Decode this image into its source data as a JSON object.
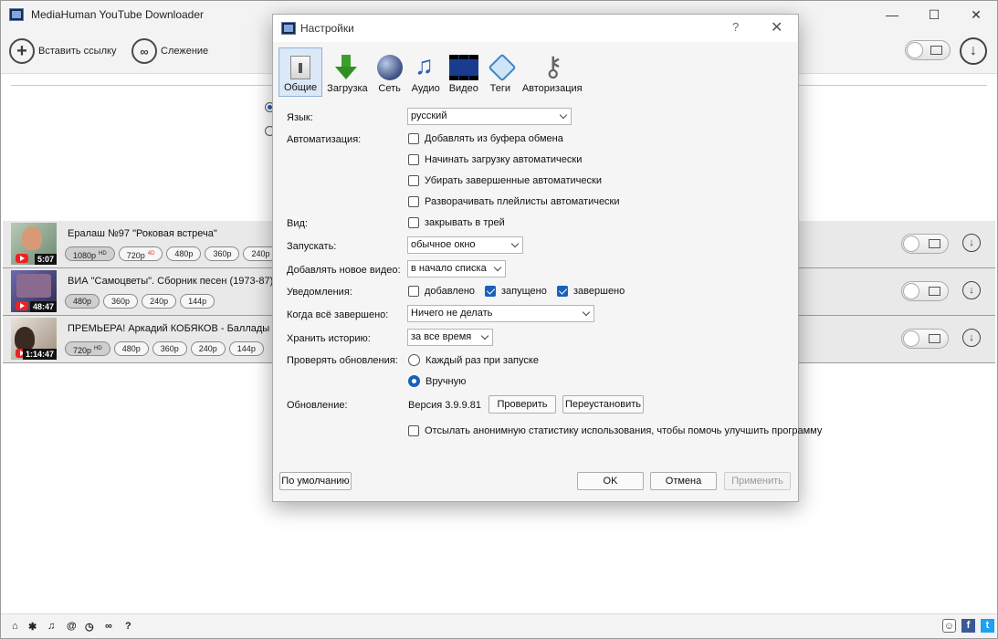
{
  "app": {
    "title": "MediaHuman YouTube Downloader",
    "window_controls": {
      "minimize": "—",
      "maximize": "☐",
      "close": "✕"
    }
  },
  "toolbar": {
    "paste_label": "Вставить ссылку",
    "tracking_label": "Слежение",
    "paste_icon": "plus-circle-icon",
    "tracking_icon": "binoculars-icon"
  },
  "downloads": [
    {
      "title": "Ералаш №97 \"Роковая встреча\"",
      "duration": "5:07",
      "formats": [
        "1080p",
        "720p",
        "480p",
        "360p",
        "240p"
      ],
      "badges": [
        "HD",
        "4D"
      ]
    },
    {
      "title": "ВИА \"Самоцветы\". Сборник песен (1973-87)",
      "duration": "48:47",
      "formats": [
        "480p",
        "360p",
        "240p",
        "144p"
      ]
    },
    {
      "title": "ПРЕМЬЕРА! Аркадий КОБЯКОВ - Баллады и",
      "duration": "1:14:47",
      "formats": [
        "720p",
        "480p",
        "360p",
        "240p",
        "144p"
      ],
      "badges": [
        "HD"
      ]
    }
  ],
  "statusbar": {
    "icons": [
      "mouse-icon",
      "gear-icon",
      "music-icon",
      "snail-icon",
      "clock-icon",
      "binoculars-icon",
      "help-icon"
    ],
    "help_glyph": "?",
    "social": {
      "facebook": "f",
      "twitter": "t"
    }
  },
  "dialog": {
    "title": "Настройки",
    "help": "?",
    "close": "✕",
    "tabs": [
      {
        "label": "Общие",
        "icon": "switch-icon",
        "active": true
      },
      {
        "label": "Загрузка",
        "icon": "download-arrow-icon"
      },
      {
        "label": "Сеть",
        "icon": "globe-icon"
      },
      {
        "label": "Аудио",
        "icon": "music-note-icon"
      },
      {
        "label": "Видео",
        "icon": "film-icon"
      },
      {
        "label": "Теги",
        "icon": "tag-icon"
      },
      {
        "label": "Авторизация",
        "icon": "keys-icon"
      }
    ],
    "language": {
      "label": "Язык:",
      "value": "русский"
    },
    "automation": {
      "label": "Автоматизация:",
      "options": [
        {
          "label": "Добавлять из буфера обмена",
          "checked": false
        },
        {
          "label": "Начинать загрузку автоматически",
          "checked": false
        },
        {
          "label": "Убирать завершенные автоматически",
          "checked": false
        },
        {
          "label": "Разворачивать плейлисты автоматически",
          "checked": false
        }
      ]
    },
    "view": {
      "label": "Вид:",
      "option": "закрывать в трей",
      "checked": false
    },
    "launch": {
      "label": "Запускать:",
      "value": "обычное окно"
    },
    "add_video": {
      "label": "Добавлять новое видео:",
      "value": "в начало списка"
    },
    "notifications": {
      "label": "Уведомления:",
      "options": [
        {
          "label": "добавлено",
          "checked": false
        },
        {
          "label": "запущено",
          "checked": true
        },
        {
          "label": "завершено",
          "checked": true
        }
      ]
    },
    "when_done": {
      "label": "Когда всё завершено:",
      "value": "Ничего не делать"
    },
    "history": {
      "label": "Хранить историю:",
      "value": "за все время"
    },
    "check_updates": {
      "label": "Проверять обновления:",
      "options": [
        {
          "label": "Каждый раз при запуске",
          "selected": false
        },
        {
          "label": "Вручную",
          "selected": true
        }
      ]
    },
    "update": {
      "label": "Обновление:",
      "version": "Версия 3.9.9.81",
      "check_button": "Проверить",
      "reinstall_button": "Переустановить"
    },
    "stats": {
      "label": "Отсылать анонимную статистику использования, чтобы помочь улучшить программу",
      "checked": false
    },
    "buttons": {
      "defaults": "По умолчанию",
      "ok": "OK",
      "cancel": "Отмена",
      "apply": "Применить"
    }
  }
}
